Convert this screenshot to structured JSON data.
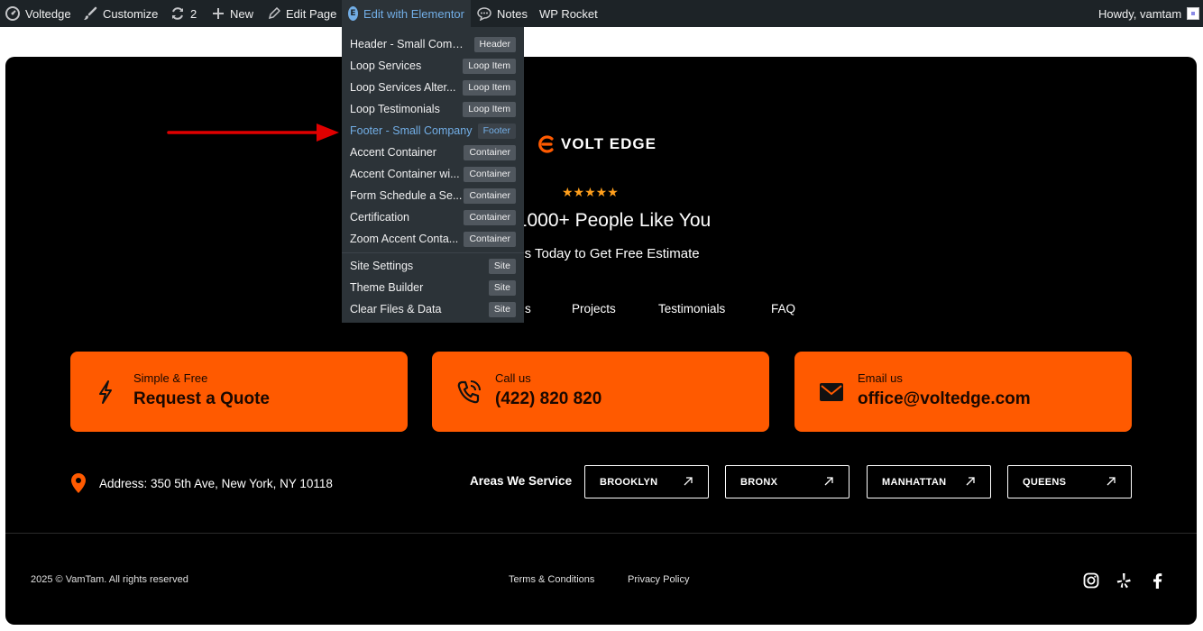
{
  "admin_bar": {
    "site_name": "Voltedge",
    "customize": "Customize",
    "updates_count": "2",
    "new": "New",
    "edit_page": "Edit Page",
    "edit_with_elementor": "Edit with Elementor",
    "elementor_badge": "E",
    "notes": "Notes",
    "wp_rocket": "WP Rocket",
    "howdy": "Howdy, vamtam"
  },
  "elementor_menu": {
    "items": [
      {
        "label": "Header - Small Comp...",
        "badge": "Header"
      },
      {
        "label": "Loop Services",
        "badge": "Loop Item"
      },
      {
        "label": "Loop Services Alter...",
        "badge": "Loop Item"
      },
      {
        "label": "Loop Testimonials",
        "badge": "Loop Item"
      },
      {
        "label": "Footer - Small Company",
        "badge": "Footer"
      },
      {
        "label": "Accent Container",
        "badge": "Container"
      },
      {
        "label": "Accent Container wi...",
        "badge": "Container"
      },
      {
        "label": "Form Schedule a Se...",
        "badge": "Container"
      },
      {
        "label": "Certification",
        "badge": "Container"
      },
      {
        "label": "Zoom Accent Conta...",
        "badge": "Container"
      },
      {
        "label": "Site Settings",
        "badge": "Site"
      },
      {
        "label": "Theme Builder",
        "badge": "Site"
      },
      {
        "label": "Clear Files & Data",
        "badge": "Site"
      }
    ]
  },
  "footer": {
    "logo_text": "VOLT EDGE",
    "stars": "★★★★★",
    "rating_title": "by 1000+ People Like You",
    "contact_subtitle": "ct us Today to Get Free Estimate",
    "nav": [
      "s",
      "Projects",
      "Testimonials",
      "FAQ"
    ],
    "cards": [
      {
        "small": "Simple & Free",
        "big": "Request a Quote",
        "icon": "bolt-icon"
      },
      {
        "small": "Call us",
        "big": "(422) 820 820",
        "icon": "phone-icon"
      },
      {
        "small": "Email us",
        "big": "office@voltedge.com",
        "icon": "mail-icon"
      }
    ],
    "address": "Address: 350 5th Ave, New York, NY 10118",
    "areas_label": "Areas We Service",
    "areas": [
      "BROOKLYN",
      "BRONX",
      "MANHATTAN",
      "QUEENS"
    ],
    "copyright": "2025 © VamTam. All rights reserved",
    "terms": "Terms & Conditions",
    "privacy": "Privacy Policy",
    "social_icons": [
      "instagram-icon",
      "yelp-icon",
      "facebook-icon"
    ]
  },
  "colors": {
    "admin_bar_bg": "#1d2327",
    "menu_bg": "#2c3338",
    "accent_blue": "#72aee6",
    "brand_orange": "#ff5a00",
    "star": "#ff9f1c",
    "annotation_red": "#e00000"
  }
}
